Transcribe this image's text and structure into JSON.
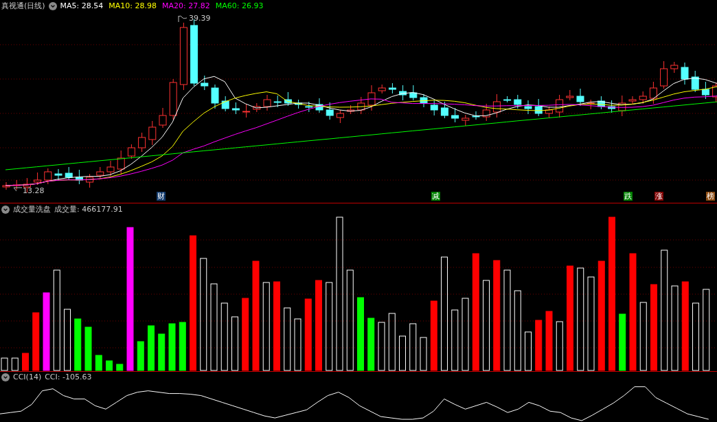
{
  "title": "真视通(日线)",
  "ma_legend": [
    {
      "label": "MA5: 28.54",
      "color": "#ffffff"
    },
    {
      "label": "MA10: 28.98",
      "color": "#ffff00"
    },
    {
      "label": "MA20: 27.82",
      "color": "#ff00ff"
    },
    {
      "label": "MA60: 26.93",
      "color": "#00ff00"
    }
  ],
  "price_labels": {
    "high": "39.39",
    "low": "13.28"
  },
  "markers": [
    {
      "label": "财",
      "color": "#143c6e"
    },
    {
      "label": "减",
      "color": "#008000"
    },
    {
      "label": "跌",
      "color": "#008000"
    },
    {
      "label": "涨",
      "color": "#800000"
    },
    {
      "label": "榜",
      "color": "#8b4a10"
    }
  ],
  "volume_panel": {
    "title": "成交量洗盘",
    "reading": "成交量: 466177.91"
  },
  "cci_panel": {
    "title": "CCI(14)",
    "reading": "CCI: -105.63"
  }
}
